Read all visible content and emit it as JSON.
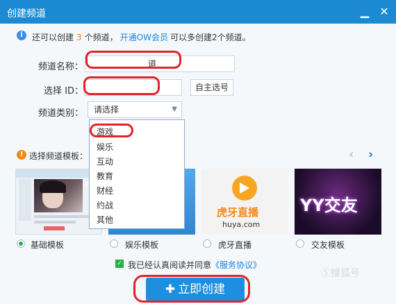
{
  "window": {
    "title": "创建频道"
  },
  "notice": {
    "prefix": "还可以创建",
    "count": "3",
    "suffix": "个频道，",
    "link": "开通OW会员",
    "tail": "可以多创建2个频道。"
  },
  "form": {
    "name_label": "频道名称：",
    "name_value": "道",
    "id_label": "选择 ID：",
    "id_value": "",
    "self_select": "自主选号",
    "category_label": "频道类别：",
    "category_value": "请选择"
  },
  "category_options": [
    "游戏",
    "娱乐",
    "互动",
    "教育",
    "财经",
    "约战",
    "其他"
  ],
  "templates": {
    "section_title": "选择频道模板：",
    "items": [
      {
        "label": "基础模板",
        "selected": true
      },
      {
        "label": "娱乐模板",
        "selected": false
      },
      {
        "label": "虎牙直播",
        "selected": false
      },
      {
        "label": "交友模板",
        "selected": false
      }
    ],
    "huya_logo": "虎牙直播",
    "huya_domain": "huya.com",
    "yy_logo": "YY交友",
    "preview_name": "小小蛋"
  },
  "agreement": {
    "text": "我已经认真阅读并同意",
    "link": "《服务协议》"
  },
  "create_button": "立即创建",
  "watermark": "Ⓢ搜狐号",
  "colors": {
    "accent": "#1d8fe0",
    "orange": "#f07a1c",
    "green": "#27b04a",
    "highlight": "#e0232a"
  }
}
